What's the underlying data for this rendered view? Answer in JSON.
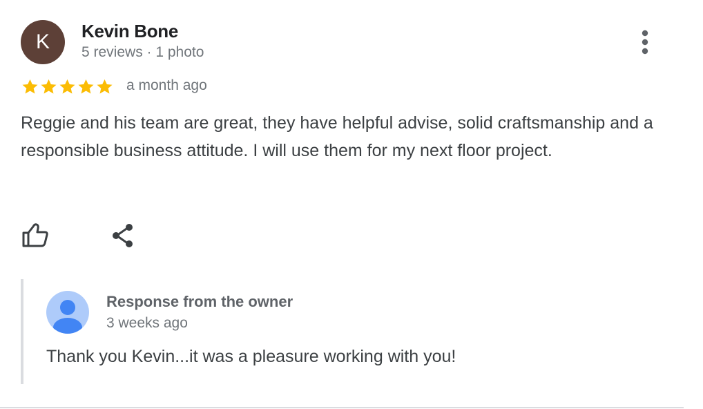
{
  "review": {
    "avatar_letter": "K",
    "avatar_color": "#5d4037",
    "reviewer_name": "Kevin Bone",
    "reviewer_meta": "5 reviews · 1 photo",
    "rating": 5,
    "rating_max": 5,
    "star_color": "#fbbc04",
    "time": "a month ago",
    "text": "Reggie and his team are great, they have helpful advise, solid craftsmanship and a responsible business attitude. I will use them for my next floor project.",
    "actions": {
      "like_icon": "thumbs-up-icon",
      "share_icon": "share-icon",
      "more_icon": "more-vert-icon"
    }
  },
  "owner_response": {
    "title": "Response from the owner",
    "time": "3 weeks ago",
    "text": "Thank you Kevin...it was a pleasure working with you!",
    "avatar_icon": "person-icon",
    "avatar_colors": {
      "background": "#aecbfa",
      "figure": "#4285f4"
    }
  }
}
